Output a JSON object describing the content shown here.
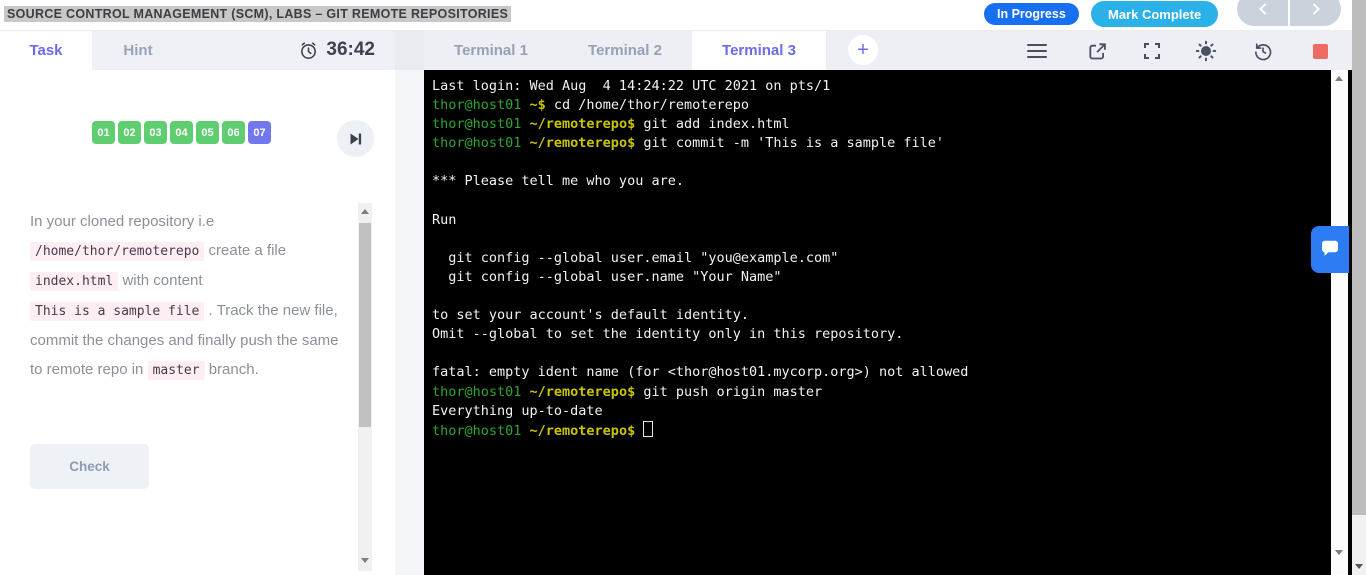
{
  "page": {
    "title": "SOURCE CONTROL MANAGEMENT (SCM), LABS – GIT REMOTE REPOSITORIES"
  },
  "header": {
    "status_label": "In Progress",
    "complete_label": "Mark Complete"
  },
  "left_panel": {
    "tabs": [
      {
        "label": "Task",
        "active": true
      },
      {
        "label": "Hint",
        "active": false
      }
    ],
    "timer": "36:42",
    "steps": [
      {
        "label": "01",
        "state": "done"
      },
      {
        "label": "02",
        "state": "done"
      },
      {
        "label": "03",
        "state": "done"
      },
      {
        "label": "04",
        "state": "done"
      },
      {
        "label": "05",
        "state": "done"
      },
      {
        "label": "06",
        "state": "done"
      },
      {
        "label": "07",
        "state": "current"
      }
    ],
    "task": {
      "segments": [
        [
          "t",
          "In your cloned repository i.e "
        ],
        [
          "c",
          "/home/thor/remoterepo"
        ],
        [
          "t",
          " create a file "
        ],
        [
          "c",
          "index.html"
        ],
        [
          "t",
          " with content "
        ],
        [
          "c",
          "This is a sample file"
        ],
        [
          "t",
          " . Track the new file, commit the changes and finally push the same to remote repo in "
        ],
        [
          "c",
          "master"
        ],
        [
          "t",
          " branch."
        ]
      ]
    },
    "check_label": "Check"
  },
  "terminal_panel": {
    "tabs": [
      {
        "label": "Terminal 1",
        "active": false
      },
      {
        "label": "Terminal 2",
        "active": false
      },
      {
        "label": "Terminal 3",
        "active": true
      }
    ],
    "add_tab_label": "+",
    "toolbar_icons": [
      "menu-icon",
      "open-in-new-icon",
      "fullscreen-icon",
      "brightness-icon",
      "history-icon",
      "stop-icon"
    ],
    "terminal": {
      "lines": [
        {
          "segs": [
            [
              "fg",
              "Last login: Wed Aug  4 14:24:22 UTC 2021 on pts/1"
            ]
          ]
        },
        {
          "segs": [
            [
              "green",
              "thor@host01"
            ],
            [
              "yellow",
              " ~$"
            ],
            [
              "fg",
              " cd /home/thor/remoterepo"
            ]
          ]
        },
        {
          "segs": [
            [
              "green",
              "thor@host01"
            ],
            [
              "yellow",
              " ~/remoterepo$"
            ],
            [
              "fg",
              " git add index.html"
            ]
          ]
        },
        {
          "segs": [
            [
              "green",
              "thor@host01"
            ],
            [
              "yellow",
              " ~/remoterepo$"
            ],
            [
              "fg",
              " git commit -m 'This is a sample file'"
            ]
          ]
        },
        {
          "segs": []
        },
        {
          "segs": [
            [
              "fg",
              "*** Please tell me who you are."
            ]
          ]
        },
        {
          "segs": []
        },
        {
          "segs": [
            [
              "fg",
              "Run"
            ]
          ]
        },
        {
          "segs": []
        },
        {
          "segs": [
            [
              "fg",
              "  git config --global user.email \"you@example.com\""
            ]
          ]
        },
        {
          "segs": [
            [
              "fg",
              "  git config --global user.name \"Your Name\""
            ]
          ]
        },
        {
          "segs": []
        },
        {
          "segs": [
            [
              "fg",
              "to set your account's default identity."
            ]
          ]
        },
        {
          "segs": [
            [
              "fg",
              "Omit --global to set the identity only in this repository."
            ]
          ]
        },
        {
          "segs": []
        },
        {
          "segs": [
            [
              "fg",
              "fatal: empty ident name (for <thor@host01.mycorp.org>) not allowed"
            ]
          ]
        },
        {
          "segs": [
            [
              "green",
              "thor@host01"
            ],
            [
              "yellow",
              " ~/remoterepo$"
            ],
            [
              "fg",
              " git push origin master"
            ]
          ]
        },
        {
          "segs": [
            [
              "fg",
              "Everything up-to-date"
            ]
          ]
        },
        {
          "segs": [
            [
              "green",
              "thor@host01"
            ],
            [
              "yellow",
              " ~/remoterepo$"
            ],
            [
              "fg",
              " "
            ]
          ],
          "cursor": true
        }
      ]
    }
  },
  "colors": {
    "accent_blue": "#176ff2",
    "sky_blue": "#2ab2e8",
    "tab_purple": "#6b6ce8",
    "step_green": "#5fce70",
    "step_purple": "#7277ee",
    "code_bg_pink": "#fdeef4",
    "terminal_bg": "#000000",
    "terminal_green": "#2ea52e",
    "terminal_yellow": "#c9c400",
    "stop_red": "#ed6b63",
    "chat_blue": "#2e7cf3"
  }
}
